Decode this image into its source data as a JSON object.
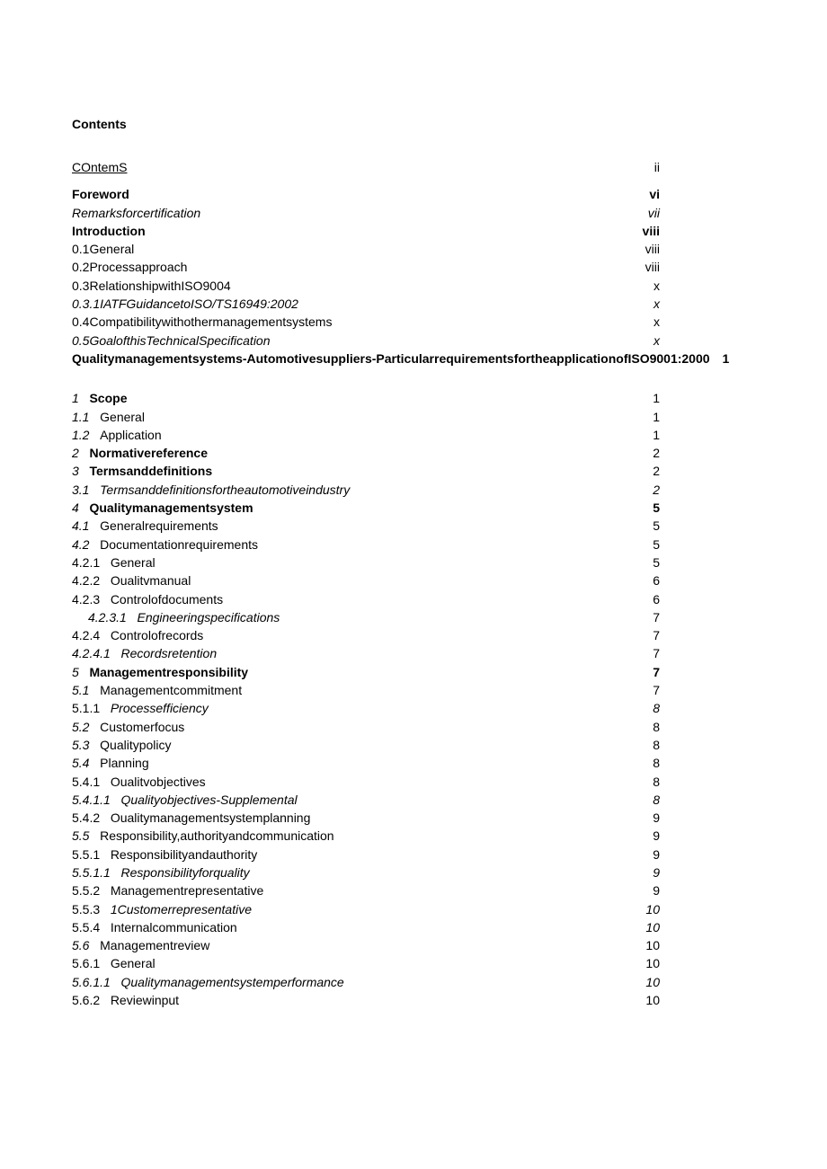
{
  "heading": "Contents",
  "contents_link": {
    "label": "COntemS",
    "page": "ii"
  },
  "front_matter": [
    {
      "label": "Foreword",
      "page": "vi",
      "bold": true
    },
    {
      "label": "Remarksforcertification",
      "page": "vii",
      "italic": true
    },
    {
      "label": "Introduction",
      "page": "viii",
      "bold": true
    },
    {
      "label": "0.1General",
      "page": "viii"
    },
    {
      "label": "0.2Processapproach",
      "page": "viii"
    },
    {
      "label": "0.3RelationshipwithISO9004",
      "page": "x"
    },
    {
      "label": "0.3.1IATFGuidancetoISO/TS16949:2002",
      "page": "x",
      "italic": true
    },
    {
      "label": "0.4Compatibilitywithothermanagementsystems",
      "page": "x"
    },
    {
      "label": "0.5GoalofthisTechnicalSpecification",
      "page": "x",
      "italic": true
    }
  ],
  "long_title": {
    "label": "Qualitymanagementsystems-Automotivesuppliers-ParticularrequirementsfortheapplicationofISO9001:2000",
    "page": "1"
  },
  "toc": [
    {
      "num": "1",
      "text": "Scope",
      "page": "1",
      "bold_text": true,
      "italic_num": true
    },
    {
      "num": "1.1",
      "text": "General",
      "page": "1",
      "italic_num": true
    },
    {
      "num": "1.2",
      "text": "Application",
      "page": "1",
      "italic_num": true
    },
    {
      "num": "2",
      "text": "Normativereference",
      "page": "2",
      "bold_text": true,
      "italic_num": true
    },
    {
      "num": "3",
      "text": "Termsanddefinitions",
      "page": "2",
      "bold_text": true,
      "italic_num": true
    },
    {
      "num": "3.1",
      "text": "Termsanddefinitionsfortheautomotiveindustry",
      "page": "2",
      "italic_num": true,
      "italic_text": true,
      "italic_page": true
    },
    {
      "num": "4",
      "text": "Qualitymanagementsystem",
      "page": "5",
      "bold_text": true,
      "italic_num": true,
      "bold_page": true
    },
    {
      "num": "4.1",
      "text": "Generalrequirements",
      "page": "5",
      "italic_num": true
    },
    {
      "num": "4.2",
      "text": "Documentationrequirements",
      "page": "5",
      "italic_num": true
    },
    {
      "num": "4.2.1",
      "text": "General",
      "page": "5"
    },
    {
      "num": "4.2.2",
      "text": "Oualitvmanual",
      "page": "6"
    },
    {
      "num": "4.2.3",
      "text": "Controlofdocuments",
      "page": "6"
    },
    {
      "num": "4.2.3.1",
      "text": "Engineeringspecifications",
      "page": "7",
      "italic_num": true,
      "italic_text": true,
      "indent": 3
    },
    {
      "num": "4.2.4",
      "text": "Controlofrecords",
      "page": "7"
    },
    {
      "num": "4.2.4.1",
      "text": "Recordsretention",
      "page": "7",
      "italic_num": true,
      "italic_text": true
    },
    {
      "num": "5",
      "text": "Managementresponsibility",
      "page": "7",
      "bold_text": true,
      "italic_num": true,
      "bold_page": true
    },
    {
      "num": "5.1",
      "text": "Managementcommitment",
      "page": "7",
      "italic_num": true
    },
    {
      "num": "5.1.1",
      "text": "Processefficiency",
      "page": "8",
      "italic_text": true,
      "italic_page": true
    },
    {
      "num": "5.2",
      "text": "Customerfocus",
      "page": "8",
      "italic_num": true
    },
    {
      "num": "5.3",
      "text": "Qualitypolicy",
      "page": "8",
      "italic_num": true
    },
    {
      "num": "5.4",
      "text": "Planning",
      "page": "8",
      "italic_num": true
    },
    {
      "num": "5.4.1",
      "text": "Oualitvobjectives",
      "page": "8"
    },
    {
      "num": "5.4.1.1",
      "text": "Qualityobjectives-Supplemental",
      "page": "8",
      "italic_num": true,
      "italic_text": true,
      "italic_page": true
    },
    {
      "num": "5.4.2",
      "text": "Oualitymanagementsystemplanning",
      "page": "9"
    },
    {
      "num": "5.5",
      "text": "Responsibility,authorityandcommunication",
      "page": "9",
      "italic_num": true
    },
    {
      "num": "5.5.1",
      "text": "Responsibilityandauthority",
      "page": "9"
    },
    {
      "num": "5.5.1.1",
      "text": "Responsibilityforquality",
      "page": "9",
      "italic_num": true,
      "italic_text": true,
      "italic_page": true
    },
    {
      "num": "5.5.2",
      "text": "Managementrepresentative",
      "page": "9"
    },
    {
      "num": "5.5.3",
      "text": "1Customerrepresentative",
      "page": "10",
      "italic_text": true,
      "italic_page": true
    },
    {
      "num": "5.5.4",
      "text": "Internalcommunication",
      "page": "10",
      "italic_page": true
    },
    {
      "num": "5.6",
      "text": "Managementreview",
      "page": "10",
      "italic_num": true
    },
    {
      "num": "5.6.1",
      "text": "General",
      "page": "10"
    },
    {
      "num": "5.6.1.1",
      "text": "Qualitymanagementsystemperformance",
      "page": "10",
      "italic_num": true,
      "italic_text": true,
      "italic_page": true
    },
    {
      "num": "5.6.2",
      "text": "Reviewinput",
      "page": "10"
    }
  ]
}
